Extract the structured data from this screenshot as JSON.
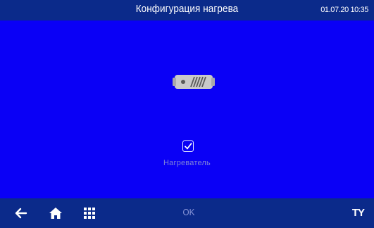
{
  "header": {
    "title": "Конфигурация нагрева",
    "datetime": "01.07.20 10:35"
  },
  "main": {
    "device_icon": "heater-icon",
    "heater_checkbox": {
      "label": "Нагреватель",
      "checked": true
    }
  },
  "footer": {
    "back_icon": "arrow-left-icon",
    "home_icon": "home-icon",
    "menu_icon": "grid-icon",
    "ok_label": "OK",
    "tools_label": "TY"
  },
  "colors": {
    "background": "#0a00f6",
    "bars": "#0b2a8a",
    "label_dim": "#7e83d8",
    "ok_dim": "#8a96d8",
    "text": "#ffffff"
  }
}
